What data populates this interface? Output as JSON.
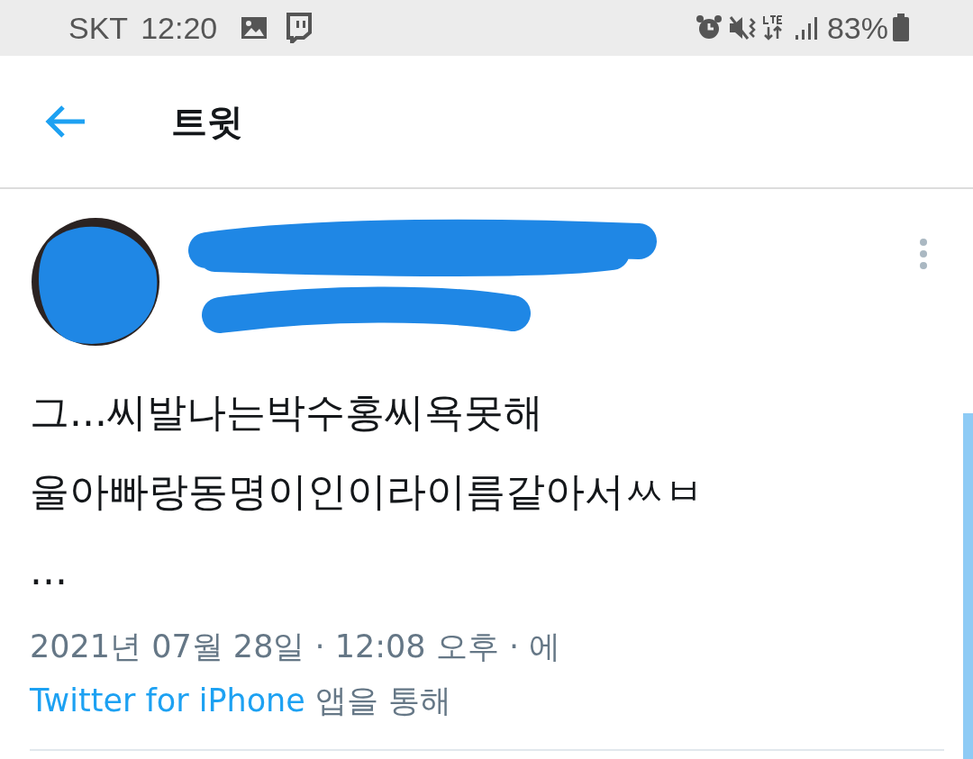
{
  "status_bar": {
    "carrier": "SKT",
    "time": "12:20",
    "battery": "83%"
  },
  "header": {
    "title": "트윗"
  },
  "tweet": {
    "text_lines": [
      "그...씨발나는박수홍씨욕못해",
      "울아빠랑동명이인이라이름같아서ㅆㅂ",
      "..."
    ],
    "timestamp": "2021년 07월 28일 · 12:08 오후 · 에",
    "source": "Twitter for iPhone",
    "source_suffix": " 앱을 통해"
  }
}
